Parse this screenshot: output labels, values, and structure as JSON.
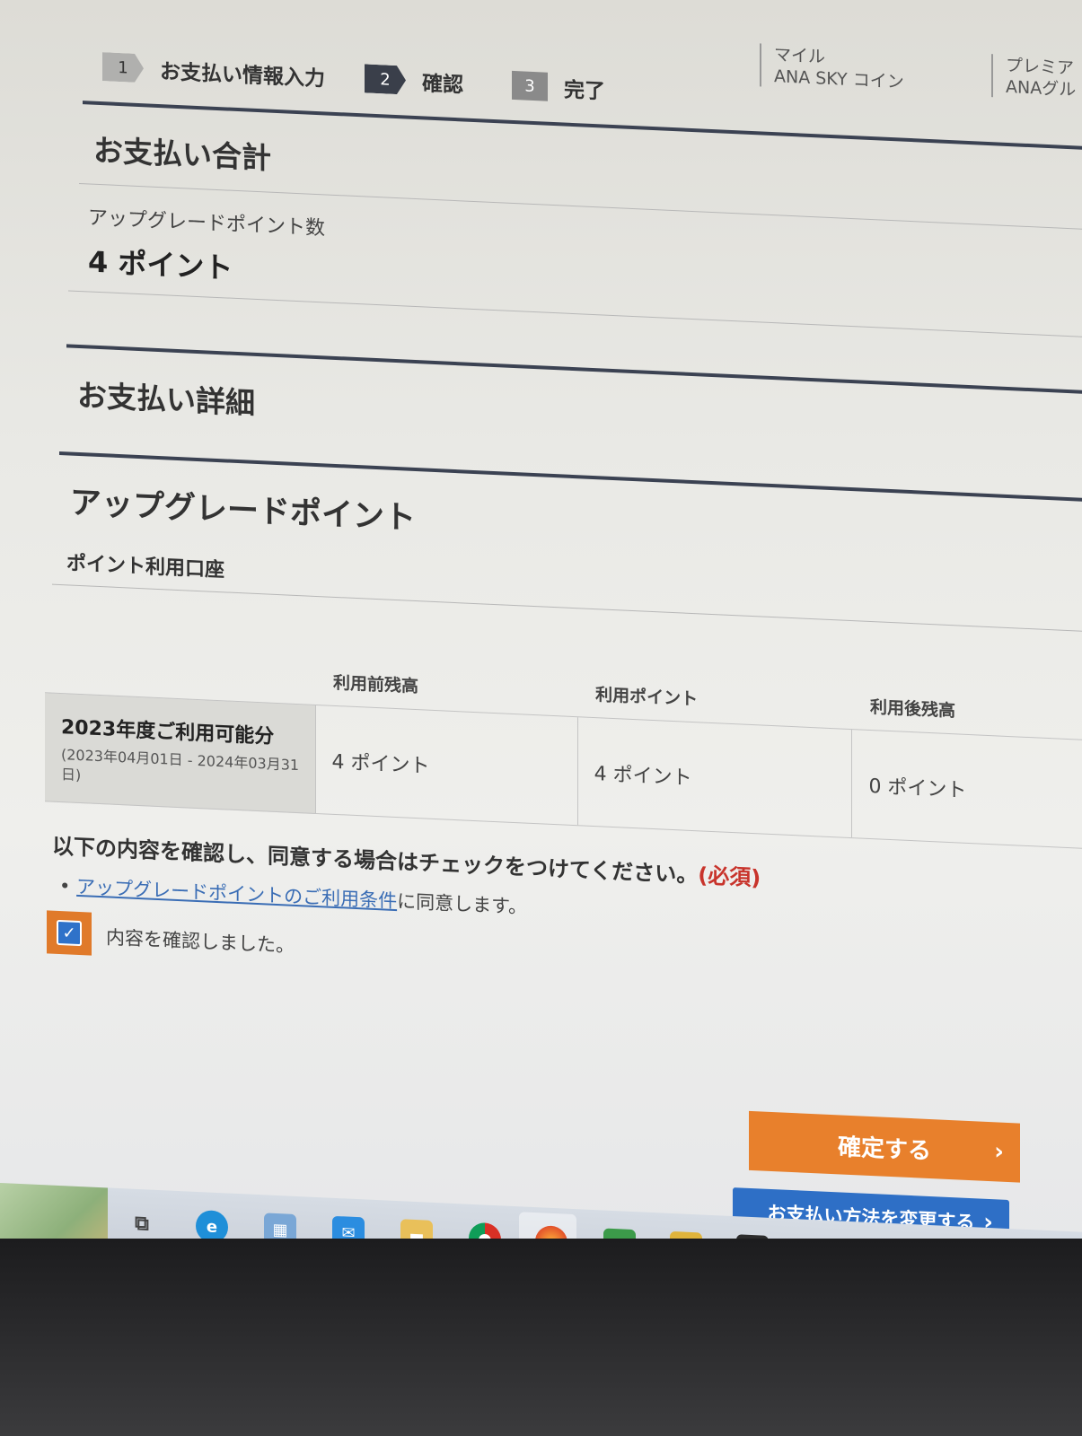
{
  "top_nav": {
    "miles_line1": "マイル",
    "miles_line2": "ANA SKY コイン",
    "premium_line1": "プレミア",
    "premium_line2": "ANAグル"
  },
  "steps": [
    {
      "number": "1",
      "label": "お支払い情報入力"
    },
    {
      "number": "2",
      "label": "確認"
    },
    {
      "number": "3",
      "label": "完了"
    }
  ],
  "payment_total": {
    "heading": "お支払い合計",
    "points_label": "アップグレードポイント数",
    "points_value": "4 ポイント"
  },
  "payment_detail": {
    "heading": "お支払い詳細",
    "section_heading": "アップグレードポイント",
    "account_label": "ポイント利用口座"
  },
  "points_table": {
    "headers": [
      "利用前残高",
      "利用ポイント",
      "利用後残高"
    ],
    "row": {
      "name": "2023年度ご利用可能分",
      "period": "(2023年04月01日 - 2024年03月31日)",
      "before": "4 ポイント",
      "used": "4 ポイント",
      "after": "0 ポイント"
    }
  },
  "agreement": {
    "instruction": "以下の内容を確認し、同意する場合はチェックをつけてください。",
    "required": "(必須)",
    "terms_link": "アップグレードポイントのご利用条件",
    "terms_suffix": "に同意します。",
    "checkbox_label": "内容を確認しました。",
    "checked": true
  },
  "buttons": {
    "confirm": "確定する",
    "change_method": "お支払い方法を変更する"
  },
  "taskbar_icons": [
    "task-view-icon",
    "edge-icon",
    "store-icon",
    "mail-icon",
    "file-explorer-icon",
    "chrome-icon",
    "firefox-icon",
    "notepad-icon",
    "text-editor-icon",
    "terminal-icon",
    "photoshop-icon",
    "app-icon",
    "acrobat-icon",
    "puzzle-icon"
  ],
  "colors": {
    "confirm_button": "#e8802c",
    "change_button": "#2e6fc6",
    "required_text": "#c8342c",
    "link": "#3a6db5"
  }
}
